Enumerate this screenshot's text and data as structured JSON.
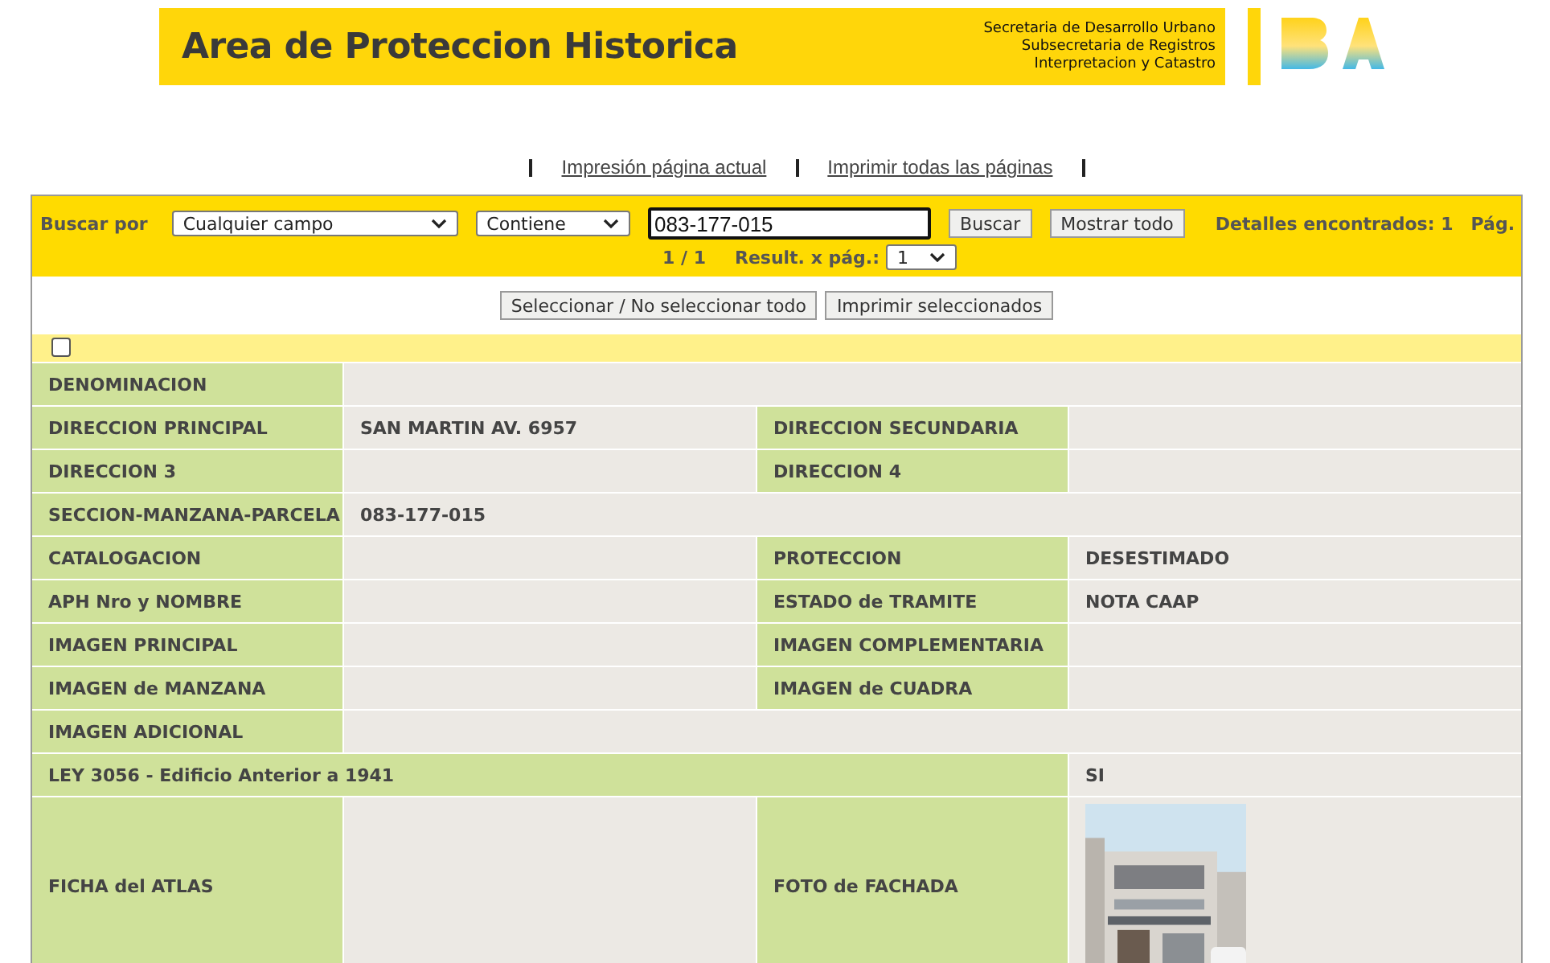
{
  "banner": {
    "title": "Area de Proteccion Historica",
    "org_lines": [
      "Secretaria de Desarrollo Urbano",
      "Subsecretaria de Registros",
      "Interpretacion y Catastro"
    ]
  },
  "print_links": [
    "Impresión página actual",
    "Imprimir todas las páginas"
  ],
  "search": {
    "label": "Buscar por",
    "field_select": "Cualquier campo",
    "match_select": "Contiene",
    "value": "083-177-015",
    "buttons": [
      "Buscar",
      "Mostrar todo"
    ],
    "found": "Detalles encontrados: 1",
    "page_label": "Pág.",
    "page_count": "1 / 1",
    "per_page_label": "Result. x pág.:",
    "per_page": "1"
  },
  "selection_buttons": [
    "Seleccionar / No seleccionar todo",
    "Imprimir seleccionados"
  ],
  "record_checkbox": {
    "checked": false
  },
  "rows": [
    {
      "kind": "single",
      "label": "DENOMINACION"
    },
    {
      "kind": "pair",
      "label": "DIRECCION PRINCIPAL",
      "value": "SAN MARTIN AV. 6957",
      "label2": "DIRECCION SECUNDARIA"
    },
    {
      "kind": "pair",
      "label": "DIRECCION 3",
      "label2": "DIRECCION 4"
    },
    {
      "kind": "single",
      "label": "SECCION-MANZANA-PARCELA",
      "value": "083-177-015"
    },
    {
      "kind": "pair",
      "label": "CATALOGACION",
      "label2": "PROTECCION",
      "value2": "DESESTIMADO"
    },
    {
      "kind": "pair",
      "label": "APH Nro y NOMBRE",
      "label2": "ESTADO de TRAMITE",
      "value2": "NOTA CAAP"
    },
    {
      "kind": "pair",
      "label": "IMAGEN PRINCIPAL",
      "label2": "IMAGEN COMPLEMENTARIA"
    },
    {
      "kind": "pair",
      "label": "IMAGEN de MANZANA",
      "label2": "IMAGEN de CUADRA"
    },
    {
      "kind": "single",
      "label": "IMAGEN ADICIONAL"
    },
    {
      "kind": "wide",
      "label": "LEY 3056 - Edificio Anterior a 1941",
      "value": "SI"
    },
    {
      "label": "FICHA del ATLAS",
      "label2": "FOTO de FACHADA"
    }
  ]
}
